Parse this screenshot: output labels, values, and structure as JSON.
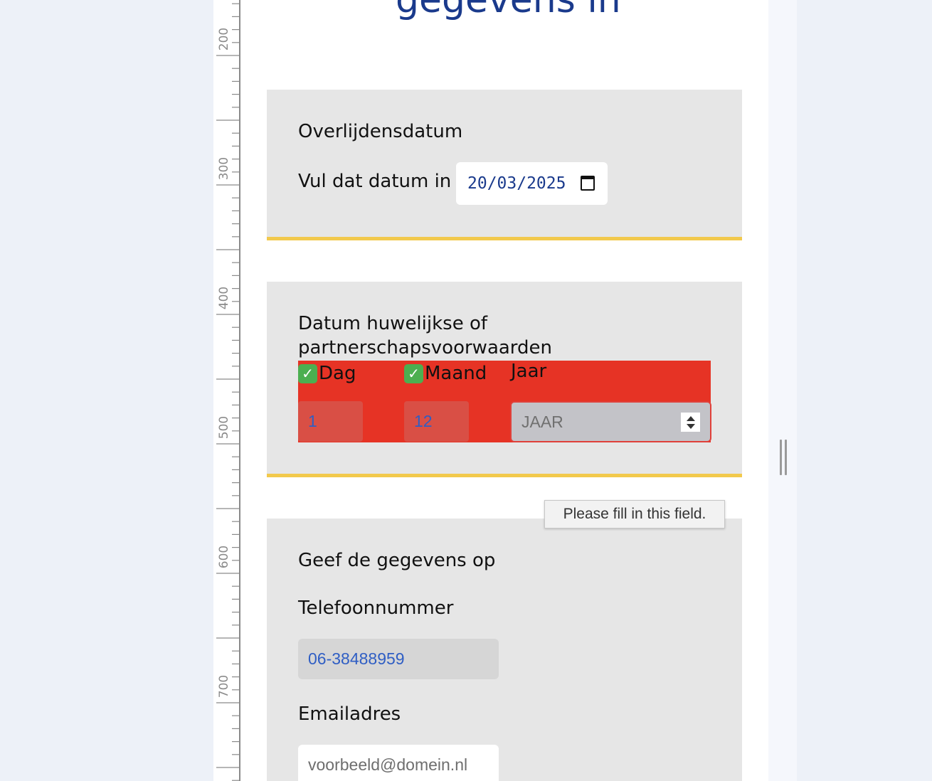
{
  "heading": {
    "partial_text": "gegevens in"
  },
  "ruler": {
    "labels": [
      "200",
      "300",
      "400",
      "500",
      "600",
      "700"
    ]
  },
  "section_overlijden": {
    "title": "Overlijdensdatum",
    "label": "Vul dat datum in",
    "date_value": "20/03/2025",
    "icon": "calendar-icon"
  },
  "section_huwelijk": {
    "title_line1": "Datum huwelijkse of",
    "title_line2": "partnerschapsvoorwaarden",
    "day": {
      "check": "✓",
      "label": "Dag",
      "value": "1"
    },
    "month": {
      "check": "✓",
      "label": "Maand",
      "value": "12"
    },
    "year": {
      "label": "Jaar",
      "placeholder": "JAAR"
    },
    "error_color": "#e63325"
  },
  "tooltip": {
    "text": "Please fill in this field."
  },
  "section_contact": {
    "title": "Geef de gegevens op",
    "phone_label": "Telefoonnummer",
    "phone_value": "06-38488959",
    "email_label": "Emailadres",
    "email_placeholder": "voorbeeld@domein.nl"
  },
  "colors": {
    "accent_yellow": "#f2c94c",
    "heading_blue": "#1a3a8c",
    "input_text_blue": "#2f5ec4",
    "card_gray": "#e6e6e6"
  }
}
